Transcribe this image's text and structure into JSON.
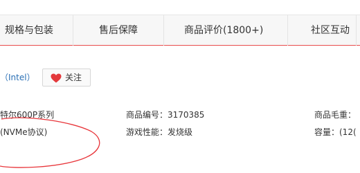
{
  "tabs": [
    {
      "label": "规格与包装"
    },
    {
      "label": "售后保障"
    },
    {
      "label": "商品评价(1800+)"
    },
    {
      "label": "社区互动"
    }
  ],
  "brand": {
    "text": "（Intel）"
  },
  "follow_button": {
    "label": "关注"
  },
  "params": {
    "row1": {
      "col1": "特尔600P系列",
      "col2": "商品编号：3170385",
      "col3": "商品毛重："
    },
    "row2": {
      "col1": "(NVMe协议)",
      "col2": "游戏性能：发烧级",
      "col3": "容量：(12("
    }
  },
  "colors": {
    "accent": "#e84b4b",
    "heart": "#e4393c",
    "link": "#2a6fb5",
    "annotation": "#e8353a"
  }
}
